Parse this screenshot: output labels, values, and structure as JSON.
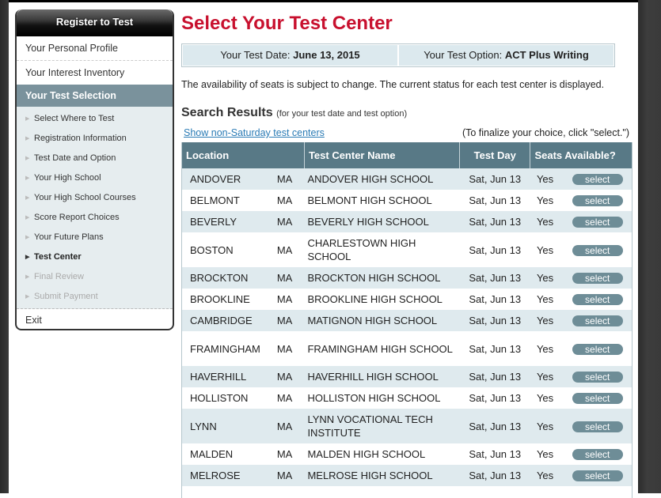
{
  "sidebar": {
    "header": "Register to Test",
    "top_items": [
      {
        "label": "Your Personal Profile"
      },
      {
        "label": "Your Interest Inventory"
      }
    ],
    "section": "Your Test Selection",
    "sub_items": [
      {
        "label": "Select Where to Test",
        "state": "done"
      },
      {
        "label": "Registration Information",
        "state": "done"
      },
      {
        "label": "Test Date and Option",
        "state": "done"
      },
      {
        "label": "Your High School",
        "state": "done"
      },
      {
        "label": "Your High School Courses",
        "state": "done"
      },
      {
        "label": "Score Report Choices",
        "state": "done"
      },
      {
        "label": "Your Future Plans",
        "state": "done"
      },
      {
        "label": "Test Center",
        "state": "current"
      },
      {
        "label": "Final Review",
        "state": "disabled"
      },
      {
        "label": "Submit Payment",
        "state": "disabled"
      }
    ],
    "exit": "Exit",
    "arrow_glyph": "▶"
  },
  "main": {
    "title": "Select Your Test Center",
    "test_date_label": "Your Test Date:",
    "test_date_value": "June 13, 2015",
    "test_option_label": "Your Test Option:",
    "test_option_value": "ACT Plus Writing",
    "availability_note": "The availability of seats is subject to change. The current status for each test center is displayed.",
    "results_title": "Search Results",
    "results_subtitle": "(for your test date and test option)",
    "non_saturday_link": "Show non-Saturday test centers",
    "finalize_note": "(To finalize your choice, click \"select.\")",
    "table": {
      "headers": {
        "location": "Location",
        "name": "Test Center Name",
        "day": "Test Day",
        "seats": "Seats Available?"
      },
      "select_label": "select",
      "rows": [
        {
          "city": "ANDOVER",
          "state": "MA",
          "name": "ANDOVER HIGH SCHOOL",
          "day": "Sat, Jun 13",
          "seats": "Yes"
        },
        {
          "city": "BELMONT",
          "state": "MA",
          "name": "BELMONT HIGH SCHOOL",
          "day": "Sat, Jun 13",
          "seats": "Yes"
        },
        {
          "city": "BEVERLY",
          "state": "MA",
          "name": "BEVERLY HIGH SCHOOL",
          "day": "Sat, Jun 13",
          "seats": "Yes"
        },
        {
          "city": "BOSTON",
          "state": "MA",
          "name": "CHARLESTOWN HIGH SCHOOL",
          "day": "Sat, Jun 13",
          "seats": "Yes",
          "wrap": true
        },
        {
          "city": "BROCKTON",
          "state": "MA",
          "name": "BROCKTON HIGH SCHOOL",
          "day": "Sat, Jun 13",
          "seats": "Yes"
        },
        {
          "city": "BROOKLINE",
          "state": "MA",
          "name": "BROOKLINE HIGH SCHOOL",
          "day": "Sat, Jun 13",
          "seats": "Yes"
        },
        {
          "city": "CAMBRIDGE",
          "state": "MA",
          "name": "MATIGNON HIGH SCHOOL",
          "day": "Sat, Jun 13",
          "seats": "Yes"
        },
        {
          "city": "FRAMINGHAM",
          "state": "MA",
          "name": "FRAMINGHAM HIGH SCHOOL",
          "day": "Sat, Jun 13",
          "seats": "Yes",
          "wrap": true
        },
        {
          "city": "HAVERHILL",
          "state": "MA",
          "name": "HAVERHILL HIGH SCHOOL",
          "day": "Sat, Jun 13",
          "seats": "Yes"
        },
        {
          "city": "HOLLISTON",
          "state": "MA",
          "name": "HOLLISTON HIGH SCHOOL",
          "day": "Sat, Jun 13",
          "seats": "Yes"
        },
        {
          "city": "LYNN",
          "state": "MA",
          "name": "LYNN VOCATIONAL TECH INSTITUTE",
          "day": "Sat, Jun 13",
          "seats": "Yes",
          "wrap": true
        },
        {
          "city": "MALDEN",
          "state": "MA",
          "name": "MALDEN HIGH SCHOOL",
          "day": "Sat, Jun 13",
          "seats": "Yes"
        },
        {
          "city": "MELROSE",
          "state": "MA",
          "name": "MELROSE HIGH SCHOOL",
          "day": "Sat, Jun 13",
          "seats": "Yes"
        }
      ]
    }
  },
  "colors": {
    "title_red": "#c8102e",
    "header_teal": "#587986",
    "section_gray_blue": "#7a929c",
    "row_alt": "#dfeaee",
    "select_button": "#6e8d97",
    "link_blue": "#2a7bb5"
  }
}
